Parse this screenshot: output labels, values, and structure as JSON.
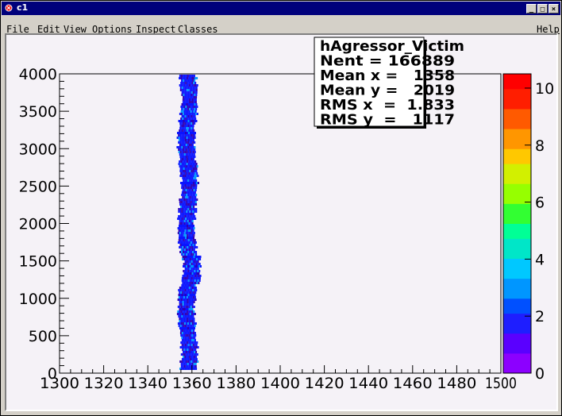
{
  "window": {
    "title": "c1"
  },
  "menu": {
    "file": "File",
    "edit": "Edit",
    "view": "View",
    "options": "Options",
    "inspect": "Inspect",
    "classes": "Classes",
    "help": "Help"
  },
  "stats": {
    "name": "hAgressor_Victim",
    "entries": "Nent = 166889",
    "mean_x": "Mean x =   1358",
    "mean_y": "Mean y =   2019",
    "rms_x": "RMS x  =  1.833",
    "rms_y": "RMS y  =   1117"
  },
  "chart_data": {
    "type": "heatmap",
    "x_ticks": [
      "1300",
      "1320",
      "1340",
      "1360",
      "1380",
      "1400",
      "1420",
      "1440",
      "1460",
      "1480",
      "1500"
    ],
    "y_ticks": [
      "0",
      "500",
      "1000",
      "1500",
      "2000",
      "2500",
      "3000",
      "3500",
      "4000"
    ],
    "xlim": [
      1300,
      1500
    ],
    "ylim": [
      0,
      4000
    ],
    "z_ticks": [
      "0",
      "2",
      "4",
      "6",
      "8",
      "10"
    ],
    "zlim": [
      0,
      10.5
    ],
    "band": {
      "x_center": 1358,
      "x_rms": 1.833,
      "y_min": 0,
      "y_max": 4000
    }
  },
  "colors": {
    "canvas_bg": "#f5f2f7",
    "titlebar": "#00007b",
    "band_main": "#0a14ff",
    "band_dark": "#2d00b4",
    "band_light": "#0096ff"
  }
}
